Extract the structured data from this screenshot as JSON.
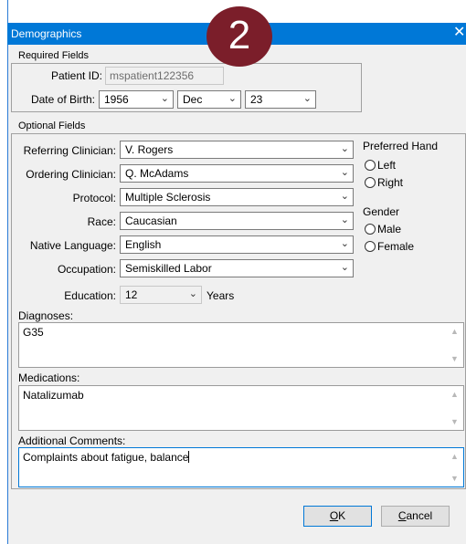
{
  "window": {
    "title": "Demographics",
    "close_glyph": "✕"
  },
  "badge": {
    "text": "2"
  },
  "required": {
    "section_label": "Required Fields",
    "patient_id_label": "Patient ID:",
    "patient_id_value": "mspatient122356",
    "dob_label": "Date of Birth:",
    "dob_year": "1956",
    "dob_month": "Dec",
    "dob_day": "23"
  },
  "optional": {
    "section_label": "Optional Fields",
    "referring_label": "Referring Clinician:",
    "referring_value": "V. Rogers",
    "ordering_label": "Ordering Clinician:",
    "ordering_value": "Q. McAdams",
    "protocol_label": "Protocol:",
    "protocol_value": "Multiple Sclerosis",
    "race_label": "Race:",
    "race_value": "Caucasian",
    "language_label": "Native Language:",
    "language_value": "English",
    "occupation_label": "Occupation:",
    "occupation_value": "Semiskilled Labor",
    "education_label": "Education:",
    "education_value": "12",
    "education_unit": "Years",
    "preferred_hand_title": "Preferred Hand",
    "hand_left": "Left",
    "hand_right": "Right",
    "gender_title": "Gender",
    "gender_male": "Male",
    "gender_female": "Female",
    "diagnoses_label": "Diagnoses:",
    "diagnoses_value": "G35",
    "medications_label": "Medications:",
    "medications_value": "Natalizumab",
    "comments_label": "Additional Comments:",
    "comments_value": "Complaints about fatigue, balance"
  },
  "buttons": {
    "ok_mnemonic": "O",
    "ok_rest": "K",
    "cancel_mnemonic": "C",
    "cancel_rest": "ancel"
  },
  "icons": {
    "dropdown": "chevron-down-icon",
    "scroll_up": "scroll-up-icon",
    "scroll_down": "scroll-down-icon",
    "close": "close-icon"
  },
  "colors": {
    "titlebar": "#0078d7",
    "badge": "#7b1e2a",
    "dialog_bg": "#f0f0f0"
  }
}
